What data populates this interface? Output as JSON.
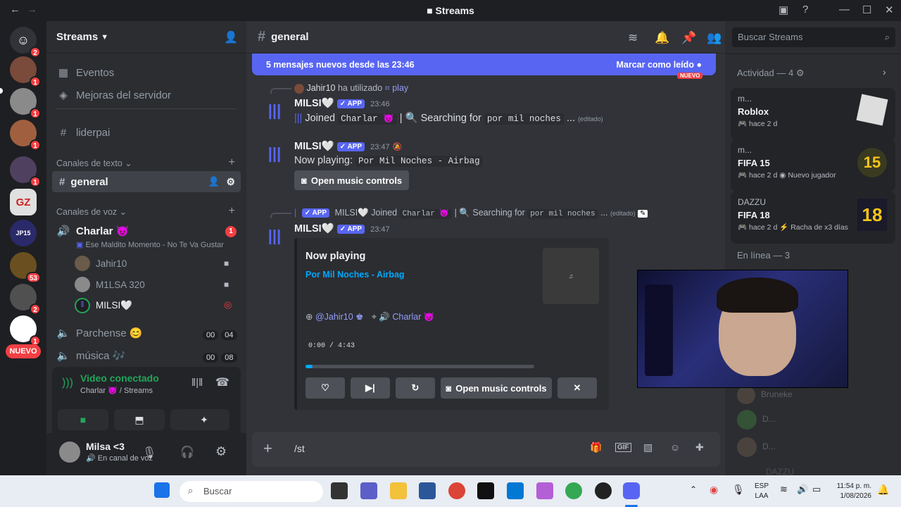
{
  "window": {
    "title": "Streams"
  },
  "guilds": {
    "badges": [
      "2",
      "1",
      "1",
      "1",
      "1",
      "53",
      "2",
      "1"
    ],
    "new_label": "NUEVO",
    "gz": "GZ",
    "jp": "JP15"
  },
  "sidebar": {
    "server_name": "Streams",
    "events": "Eventos",
    "boosts": "Mejoras del servidor",
    "liderpai": "liderpai",
    "text_category": "Canales de texto",
    "general": "general",
    "voice_category": "Canales de voz",
    "charlar": "Charlar 😈",
    "charlar_badge": "1",
    "activity": "Ese Maldito Momento - No Te Va Gustar",
    "users": [
      "Jahir10",
      "M1LSA 320",
      "MILSI🤍"
    ],
    "parchense": "Parchense 😊",
    "parchense_t": [
      "00",
      "04"
    ],
    "musica": "música 🎶",
    "musica_t": [
      "00",
      "08"
    ]
  },
  "voice": {
    "status": "Video conectado",
    "channel": "Charlar 😈 / Streams"
  },
  "user": {
    "name": "Milsa <3",
    "status": "En canal de voz"
  },
  "channel": {
    "name": "general"
  },
  "new_messages": {
    "text": "5 mensajes nuevos desde las 23:46",
    "mark": "Marcar como leído",
    "nuevo": "NUEVO"
  },
  "messages": {
    "reply1_user": "Jahir10",
    "reply1_action": "ha utilizado",
    "reply1_cmd": "play",
    "bot_name": "MILSI🤍",
    "app": "APP",
    "m1_time": "23:46",
    "m1_joined": "Joined",
    "m1_channel": "Charlar 😈",
    "m1_search": "| 🔍 Searching for",
    "m1_query": "por mil noches",
    "m1_ellipsis": "...",
    "edited": "(editado)",
    "m2_time": "23:47",
    "m2_text": "Now playing:",
    "m2_song": "Por Mil Noches - Airbag",
    "open_controls": "Open music controls",
    "reply2_text": "MILSI🤍 Joined",
    "reply2_channel": "Charlar 😈",
    "reply2_search": "| 🔍 Searching for",
    "reply2_query": "por mil noches",
    "m3_time": "23:47"
  },
  "embed": {
    "title": "Now playing",
    "song": "Por Mil Noches - Airbag",
    "requester": "@Jahir10 ♚",
    "channel": "🔊 Charlar 😈",
    "time": "0:00 / 4:43",
    "progress": 0.03,
    "open_controls": "Open music controls"
  },
  "input": {
    "value": "/st"
  },
  "activity": {
    "search_placeholder": "Buscar Streams",
    "header": "Actividad — 4",
    "cards": [
      {
        "user": "m...",
        "game": "Roblox",
        "meta": "hace 2 d",
        "extra": ""
      },
      {
        "user": "m...",
        "game": "FIFA 15",
        "meta": "hace 2 d",
        "extra": "Nuevo jugador"
      },
      {
        "user": "DAZZU",
        "game": "FIFA 18",
        "meta": "hace 2 d",
        "extra": "Racha de x3 días"
      }
    ],
    "online": "En línea — 3",
    "online_users": [
      "Bruneke",
      "D...",
      "D...",
      "DAZZU"
    ]
  },
  "taskbar": {
    "search": "Buscar",
    "lang1": "ESP",
    "lang2": "LAA",
    "time": "11:54 p. m.",
    "date": "1/08/2026"
  }
}
